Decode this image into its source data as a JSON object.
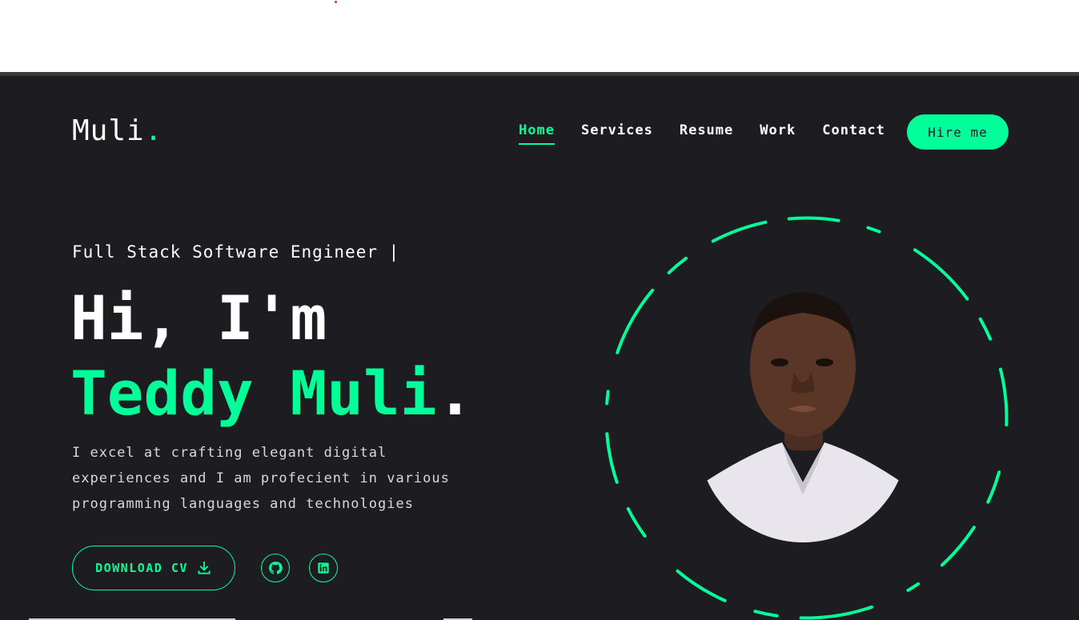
{
  "colors": {
    "accent": "#00ff99",
    "background": "#1d1c21",
    "text": "#ffffff",
    "top_dot": "#c0392b"
  },
  "header": {
    "logo": "Muli",
    "logo_dot": ".",
    "nav": [
      {
        "label": "Home",
        "active": true
      },
      {
        "label": "Services",
        "active": false
      },
      {
        "label": "Resume",
        "active": false
      },
      {
        "label": "Work",
        "active": false
      },
      {
        "label": "Contact",
        "active": false
      }
    ],
    "hire_label": "Hire me"
  },
  "hero": {
    "subtitle": "Full Stack Software Engineer |",
    "greeting": "Hi, I'm",
    "name": "Teddy Muli",
    "name_dot": ".",
    "description": "I excel at crafting elegant digital experiences and I am profecient in various programming languages and technologies",
    "cv_label": "DOWNLOAD CV",
    "cv_icon": "download-icon",
    "socials": [
      {
        "name": "github",
        "icon": "github-icon"
      },
      {
        "name": "linkedin",
        "icon": "linkedin-icon"
      }
    ],
    "photo_icon": "profile-photo"
  }
}
